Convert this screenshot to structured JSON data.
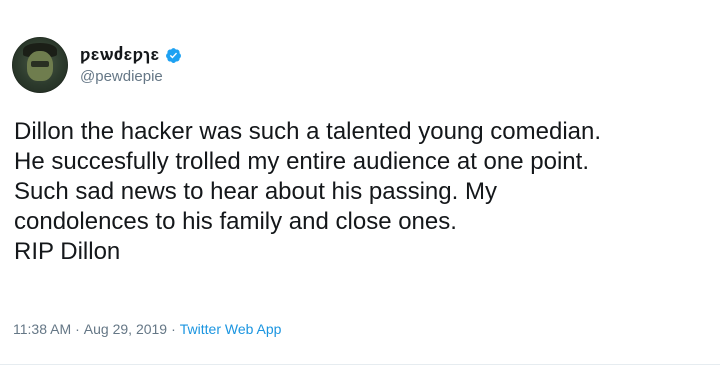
{
  "tweet": {
    "display_name": "ƿɛѡძɛƿɿɛ",
    "handle": "@pewdiepie",
    "verified_icon": "verified-badge-icon",
    "avatar_icon": "avatar",
    "body": "Dillon the hacker was such a talented young comedian.\nHe succesfully trolled my entire audience at one point.\nSuch sad news to hear about his passing. My\ncondolences to his family and close ones.\nRIP Dillon",
    "time": "11:38 AM",
    "separator": "·",
    "date": "Aug 29, 2019",
    "source": "Twitter Web App"
  },
  "colors": {
    "text": "#14171a",
    "secondary": "#657786",
    "link": "#1b95e0",
    "verified": "#1da1f2"
  }
}
